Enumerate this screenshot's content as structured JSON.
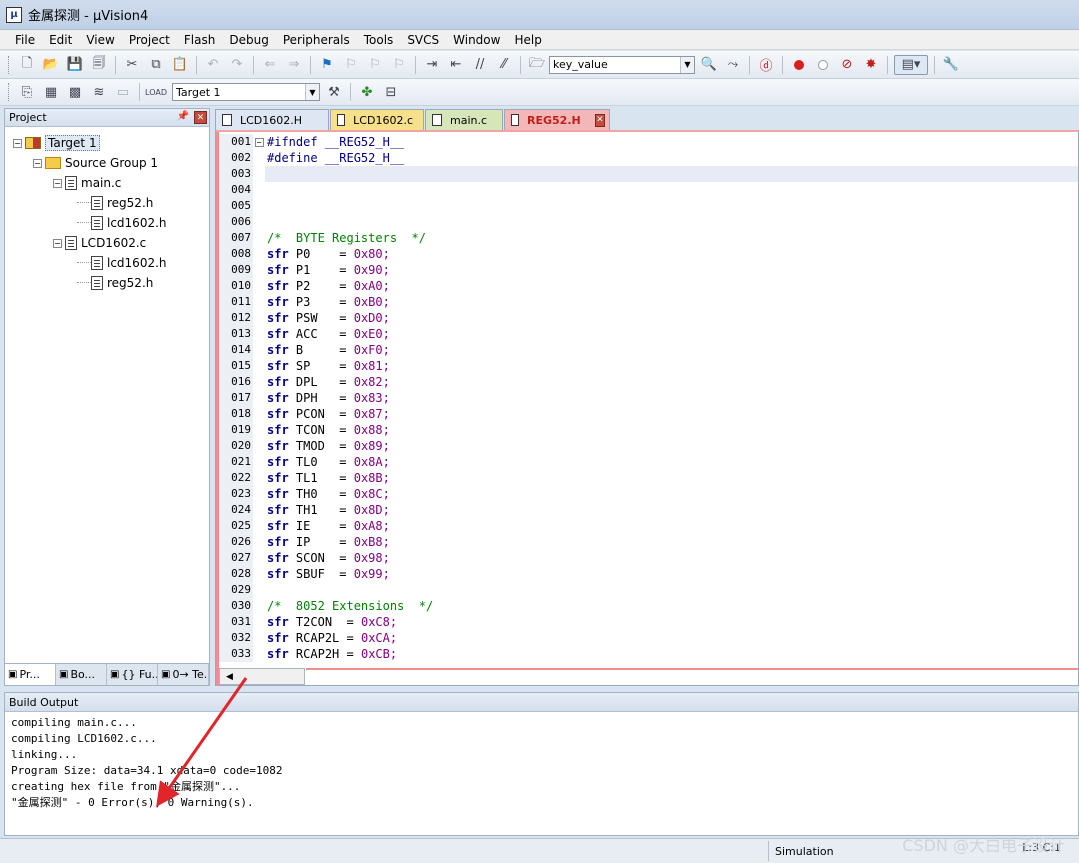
{
  "window": {
    "title": "金属探测 - μVision4",
    "app_icon": "µ"
  },
  "menu": [
    "File",
    "Edit",
    "View",
    "Project",
    "Flash",
    "Debug",
    "Peripherals",
    "Tools",
    "SVCS",
    "Window",
    "Help"
  ],
  "toolbar": {
    "find_combo_value": "key_value",
    "target_combo_value": "Target 1"
  },
  "project": {
    "header": "Project",
    "tree": [
      {
        "label": "Target 1",
        "level": 0,
        "type": "target",
        "expanded": true,
        "selected": true
      },
      {
        "label": "Source Group 1",
        "level": 1,
        "type": "folder",
        "expanded": true
      },
      {
        "label": "main.c",
        "level": 2,
        "type": "file",
        "expanded": true
      },
      {
        "label": "reg52.h",
        "level": 3,
        "type": "file"
      },
      {
        "label": "lcd1602.h",
        "level": 3,
        "type": "file"
      },
      {
        "label": "LCD1602.c",
        "level": 2,
        "type": "file",
        "expanded": true
      },
      {
        "label": "lcd1602.h",
        "level": 3,
        "type": "file"
      },
      {
        "label": "reg52.h",
        "level": 3,
        "type": "file"
      }
    ],
    "tabs": [
      {
        "label": "Pr...",
        "icon": "project-tab-icon"
      },
      {
        "label": "Bo...",
        "icon": "books-tab-icon"
      },
      {
        "label": "{} Fu...",
        "icon": "functions-tab-icon"
      },
      {
        "label": "0→ Te...",
        "icon": "templates-tab-icon"
      }
    ]
  },
  "editor": {
    "tabs": [
      {
        "label": "LCD1602.H",
        "color": "#dde6f2"
      },
      {
        "label": "LCD1602.c",
        "color": "#f7e08a"
      },
      {
        "label": "main.c",
        "color": "#d7e6b8"
      },
      {
        "label": "REG52.H",
        "color": "#f3b7b7",
        "active": true
      }
    ],
    "lines": [
      {
        "n": "001",
        "t": "#ifndef __REG52_H__",
        "k": "pre",
        "fold": true
      },
      {
        "n": "002",
        "t": "#define __REG52_H__",
        "k": "pre"
      },
      {
        "n": "003",
        "t": "",
        "k": "",
        "hl": true
      },
      {
        "n": "004",
        "t": "",
        "k": ""
      },
      {
        "n": "005",
        "t": "",
        "k": ""
      },
      {
        "n": "006",
        "t": "",
        "k": ""
      },
      {
        "n": "007",
        "t": "/*  BYTE Registers  */",
        "k": "cmt"
      },
      {
        "n": "008",
        "r": "P0   ",
        "v": "0x80;"
      },
      {
        "n": "009",
        "r": "P1   ",
        "v": "0x90;"
      },
      {
        "n": "010",
        "r": "P2   ",
        "v": "0xA0;"
      },
      {
        "n": "011",
        "r": "P3   ",
        "v": "0xB0;"
      },
      {
        "n": "012",
        "r": "PSW  ",
        "v": "0xD0;"
      },
      {
        "n": "013",
        "r": "ACC  ",
        "v": "0xE0;"
      },
      {
        "n": "014",
        "r": "B    ",
        "v": "0xF0;"
      },
      {
        "n": "015",
        "r": "SP   ",
        "v": "0x81;"
      },
      {
        "n": "016",
        "r": "DPL  ",
        "v": "0x82;"
      },
      {
        "n": "017",
        "r": "DPH  ",
        "v": "0x83;"
      },
      {
        "n": "018",
        "r": "PCON ",
        "v": "0x87;"
      },
      {
        "n": "019",
        "r": "TCON ",
        "v": "0x88;"
      },
      {
        "n": "020",
        "r": "TMOD ",
        "v": "0x89;"
      },
      {
        "n": "021",
        "r": "TL0  ",
        "v": "0x8A;"
      },
      {
        "n": "022",
        "r": "TL1  ",
        "v": "0x8B;"
      },
      {
        "n": "023",
        "r": "TH0  ",
        "v": "0x8C;"
      },
      {
        "n": "024",
        "r": "TH1  ",
        "v": "0x8D;"
      },
      {
        "n": "025",
        "r": "IE   ",
        "v": "0xA8;"
      },
      {
        "n": "026",
        "r": "IP   ",
        "v": "0xB8;"
      },
      {
        "n": "027",
        "r": "SCON ",
        "v": "0x98;"
      },
      {
        "n": "028",
        "r": "SBUF ",
        "v": "0x99;"
      },
      {
        "n": "029",
        "t": "",
        "k": ""
      },
      {
        "n": "030",
        "t": "/*  8052 Extensions  */",
        "k": "cmt"
      },
      {
        "n": "031",
        "r": "T2CON ",
        "v": "0xC8;"
      },
      {
        "n": "032",
        "r": "RCAP2L",
        "v": "0xCA;"
      },
      {
        "n": "033",
        "r": "RCAP2H",
        "v": "0xCB;"
      }
    ]
  },
  "build": {
    "header": "Build Output",
    "lines": [
      "compiling main.c...",
      "compiling LCD1602.c...",
      "linking...",
      "Program Size: data=34.1 xdata=0 code=1082",
      "creating hex file from \"金属探测\"...",
      "\"金属探测\" - 0 Error(s), 0 Warning(s)."
    ]
  },
  "status": {
    "mode": "Simulation",
    "position": "L:3 C:1",
    "watermark": "CSDN @大白电子设计"
  },
  "colors": {
    "arrow": "#e0262b"
  }
}
